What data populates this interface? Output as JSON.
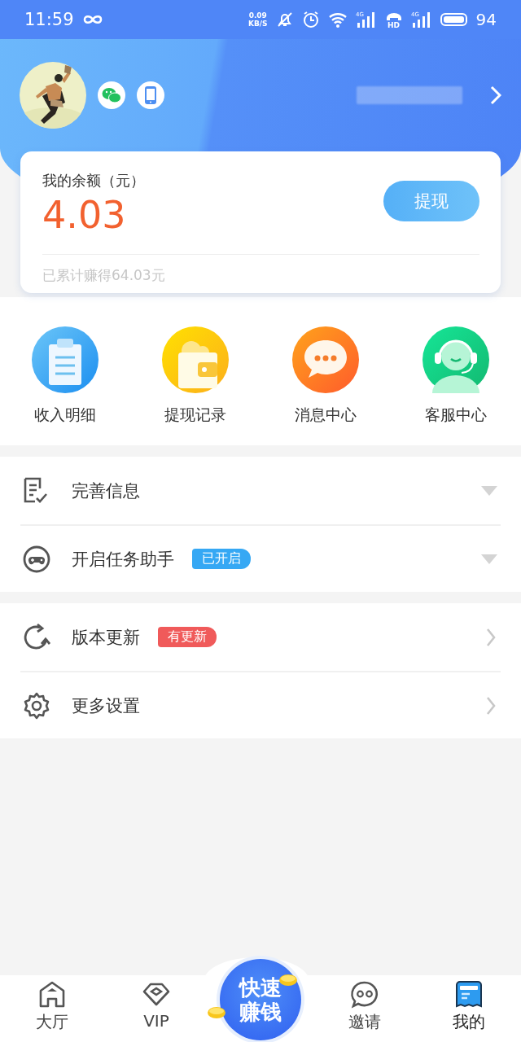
{
  "status_bar": {
    "time": "11:59",
    "speed": "0.09",
    "speed_unit": "KB/S",
    "battery": "94",
    "network_1": "4G",
    "hd": "HD",
    "network_2": "4G"
  },
  "balance": {
    "label": "我的余额（元）",
    "amount": "4.03",
    "button": "提现",
    "total": "已累计赚得64.03元"
  },
  "shortcuts": [
    {
      "kind": "clipboard",
      "label": "收入明细"
    },
    {
      "kind": "wallet",
      "label": "提现记录"
    },
    {
      "kind": "chat",
      "label": "消息中心"
    },
    {
      "kind": "agent",
      "label": "客服中心"
    }
  ],
  "sections": [
    {
      "rows": [
        {
          "label": "完善信息",
          "kind": "expand"
        },
        {
          "label": "开启任务助手",
          "kind": "expand",
          "badge": {
            "text": "已开启",
            "color": "#36a8f4"
          }
        }
      ]
    },
    {
      "rows": [
        {
          "label": "版本更新",
          "kind": "link",
          "badge": {
            "text": "有更新",
            "color": "#f05a5a"
          }
        },
        {
          "label": "更多设置",
          "kind": "link"
        }
      ]
    }
  ],
  "tabs": [
    {
      "kind": "home",
      "label": "大厅",
      "selected": false
    },
    {
      "kind": "diamond",
      "label": "VIP",
      "selected": false
    },
    {
      "kind": "center",
      "lines": [
        "快速",
        "赚钱"
      ],
      "selected": false
    },
    {
      "kind": "chat",
      "label": "邀请",
      "selected": false
    },
    {
      "kind": "card",
      "label": "我的",
      "selected": true
    }
  ]
}
